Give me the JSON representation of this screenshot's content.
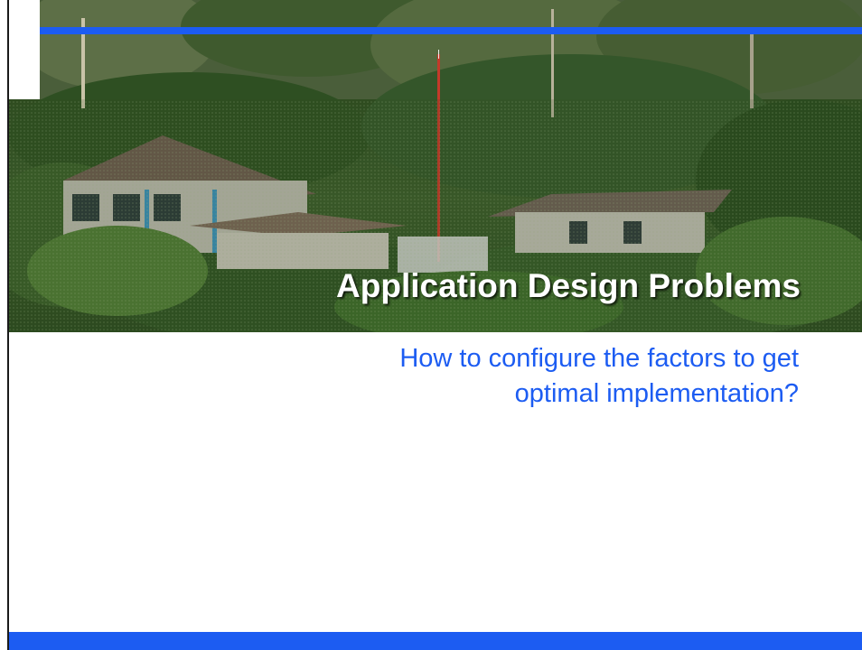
{
  "slide": {
    "title": "Application Design Problems",
    "subtitle_lines": [
      "How to configure the factors to get",
      "optimal implementation?"
    ]
  },
  "photo": {
    "subject": "village-buildings-in-forest"
  },
  "colors": {
    "accent": "#1c5cf2",
    "title_text": "#ffffff",
    "subtitle_text": "#1c5cf2"
  }
}
